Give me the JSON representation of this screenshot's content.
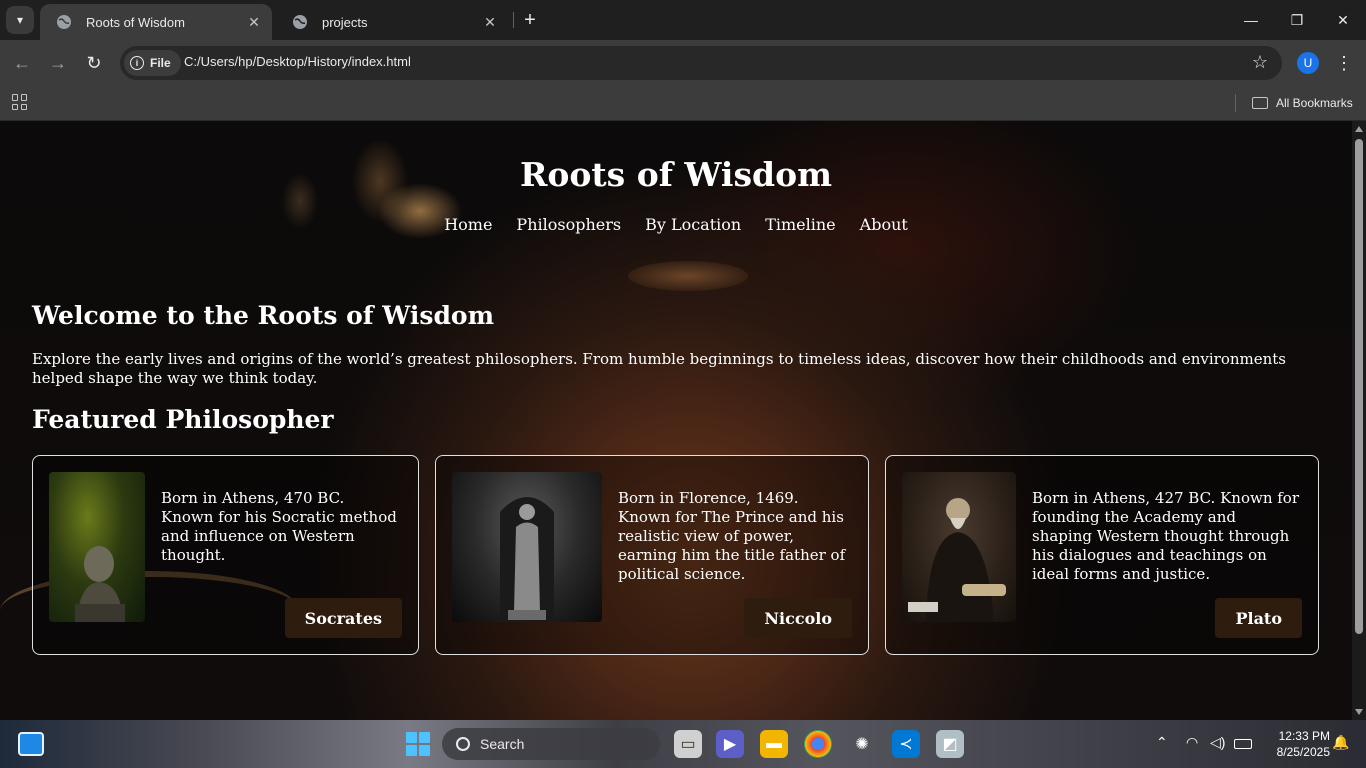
{
  "browser": {
    "tabs": [
      {
        "title": "Roots of Wisdom",
        "active": true
      },
      {
        "title": "projects",
        "active": false
      }
    ],
    "address_chip": "File",
    "url": "C:/Users/hp/Desktop/History/index.html",
    "profile_initial": "U",
    "all_bookmarks": "All Bookmarks"
  },
  "site": {
    "title": "Roots of Wisdom",
    "nav": [
      "Home",
      "Philosophers",
      "By Location",
      "Timeline",
      "About"
    ],
    "welcome_heading": "Welcome to the Roots of Wisdom",
    "welcome_text": "Explore the early lives and origins of the world’s greatest philosophers. From humble beginnings to timeless ideas, discover how their childhoods and environments helped shape the way we think today.",
    "featured_heading": "Featured Philosopher",
    "cards": [
      {
        "name": "Socrates",
        "description": "Born in Athens, 470 BC. Known for his Socratic method and influence on Western thought."
      },
      {
        "name": "Niccolo",
        "description": "Born in Florence, 1469. Known for The Prince and his realistic view of power, earning him the title father of political science."
      },
      {
        "name": "Plato",
        "description": "Born in Athens, 427 BC. Known for founding the Academy and shaping Western thought through his dialogues and teachings on ideal forms and justice."
      }
    ]
  },
  "taskbar": {
    "search_label": "Search",
    "time": "12:33 PM",
    "date": "8/25/2025"
  },
  "colors": {
    "card_button_bg": "#2e1c0e",
    "profile_bg": "#1a73e8"
  }
}
